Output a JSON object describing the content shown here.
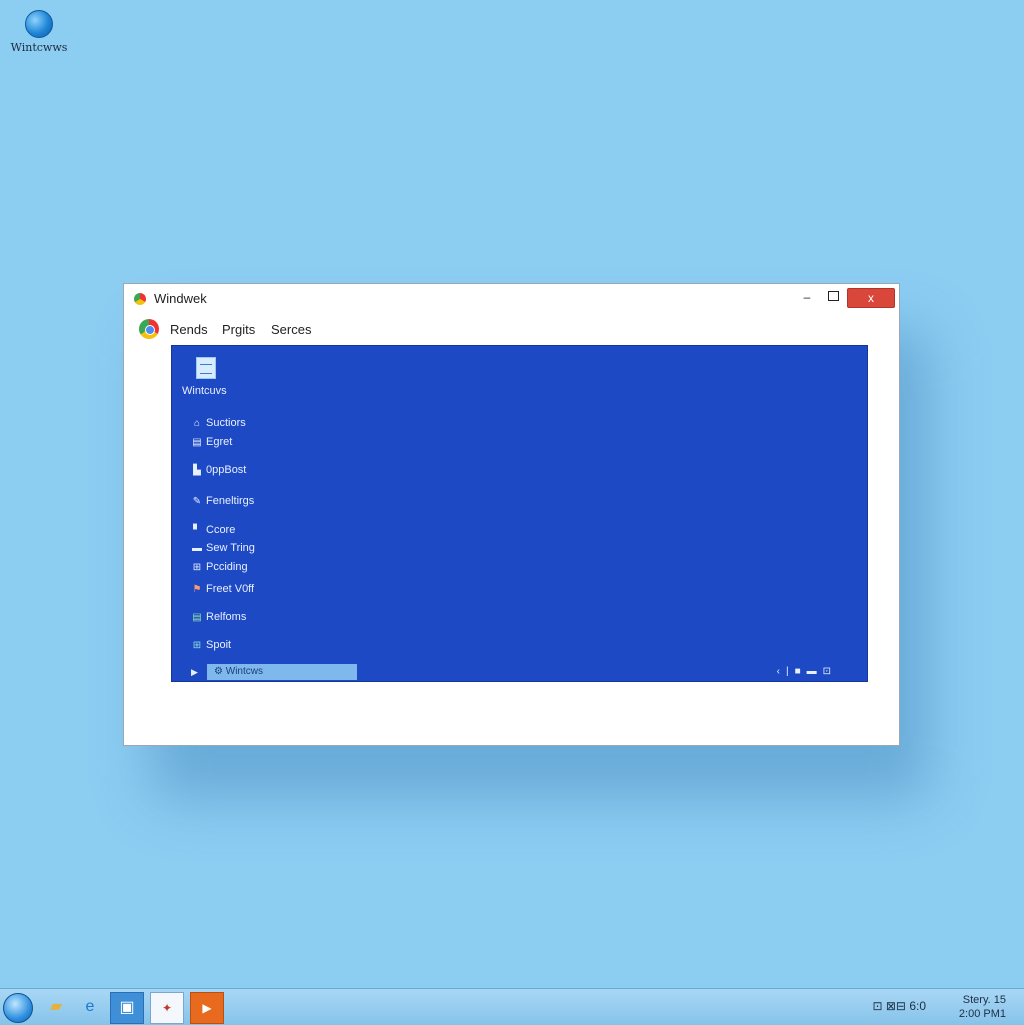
{
  "desktop": {
    "icon_label": "Wintcwws"
  },
  "window": {
    "title": "Windwek",
    "close_label": "x",
    "minimize_label": "–",
    "menu": [
      "Rends",
      "Prgits",
      "Serces"
    ],
    "content": {
      "header_label": "Wintcuvs",
      "nav_items": [
        {
          "icon": "home-icon",
          "label": "Suctiors"
        },
        {
          "icon": "list-icon",
          "label": "Egret"
        },
        {
          "icon": "bookmark-icon",
          "label": "0ppBost"
        },
        {
          "icon": "wrench-icon",
          "label": "Feneltirgs"
        },
        {
          "icon": "document-icon",
          "label": "Ccore"
        },
        {
          "icon": "window-icon",
          "label": "Sew Tring"
        },
        {
          "icon": "grid-icon",
          "label": "Pcciding"
        },
        {
          "icon": "flag-icon",
          "label": "Freet V0ff"
        },
        {
          "icon": "list-icon",
          "label": "Relfoms"
        },
        {
          "icon": "grid-icon",
          "label": "Spoit"
        }
      ],
      "bottom_field": "Wintcws"
    }
  },
  "taskbar": {
    "tray_text": "⊡ ⊠⊟ 6:0",
    "clock_line1": "Stery. 15",
    "clock_line2": "2:00 PM1"
  },
  "colors": {
    "desktop": "#8ccdf2",
    "content_panel": "#1e49c4",
    "close_button": "#d9463a"
  }
}
